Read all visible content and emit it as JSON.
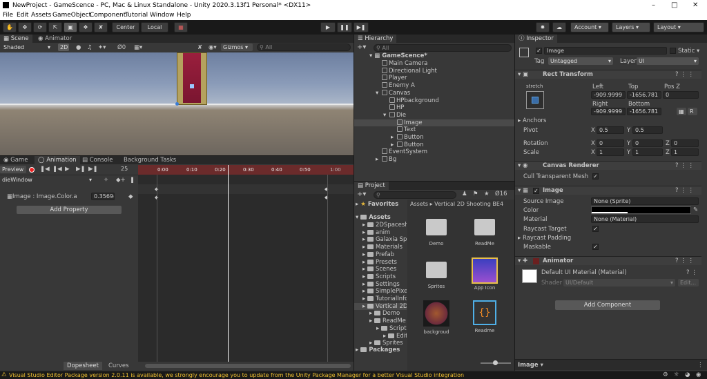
{
  "window": {
    "title": "NewProject - GameScence - PC, Mac & Linux Standalone - Unity 2020.3.13f1 Personal* <DX11>"
  },
  "menu": [
    "File",
    "Edit",
    "Assets",
    "GameObject",
    "Component",
    "Tutorial",
    "Window",
    "Help"
  ],
  "toolbar": {
    "center": "Center",
    "local": "Local",
    "account": "Account",
    "layers": "Layers",
    "layout": "Layout"
  },
  "scene": {
    "tab_scene": "Scene",
    "tab_animator": "Animator",
    "shading": "Shaded",
    "mode2d": "2D",
    "gizmos": "Gizmos",
    "search_placeholder": "All",
    "fx": "0"
  },
  "animation": {
    "tabs": [
      "Game",
      "Animation",
      "Console",
      "Background Tasks"
    ],
    "preview": "Preview",
    "frame": "25",
    "clip": "dieWindow",
    "property": "Image : Image.Color.a",
    "property_value": "0.3569(",
    "add_property": "Add Property",
    "times": [
      "0:00",
      "0:10",
      "0:20",
      "0:30",
      "0:40",
      "0:50",
      "1:00"
    ],
    "dopesheet": "Dopesheet",
    "curves": "Curves"
  },
  "hierarchy": {
    "title": "Hierarchy",
    "search_placeholder": "All",
    "scene": "GameScence*",
    "items": [
      {
        "label": "Main Camera",
        "depth": 1
      },
      {
        "label": "Directional Light",
        "depth": 1
      },
      {
        "label": "Player",
        "depth": 1
      },
      {
        "label": "Enemy A",
        "depth": 1
      },
      {
        "label": "Canvas",
        "depth": 1
      },
      {
        "label": "HPbackground",
        "depth": 2
      },
      {
        "label": "HP",
        "depth": 2
      },
      {
        "label": "Die",
        "depth": 2
      },
      {
        "label": "Image",
        "depth": 3
      },
      {
        "label": "Text",
        "depth": 3
      },
      {
        "label": "Button",
        "depth": 3
      },
      {
        "label": "Button",
        "depth": 3
      },
      {
        "label": "EventSystem",
        "depth": 1
      },
      {
        "label": "Bg",
        "depth": 1
      }
    ]
  },
  "project": {
    "title": "Project",
    "count": "16",
    "favorites": "Favorites",
    "assets": "Assets",
    "packages": "Packages",
    "folders": [
      "2DSpacesh",
      "anim",
      "Galaxia Spr",
      "Materials",
      "Prefab",
      "Presets",
      "Scenes",
      "Scripts",
      "Settings",
      "SimplePixel",
      "TutorialInfo",
      "Vertical 2D"
    ],
    "subfolders": [
      "Demo",
      "ReadMe",
      "Scripts",
      "Edit",
      "Sprites"
    ],
    "breadcrumb_root": "Assets",
    "breadcrumb_leaf": "Vertical 2D Shooting BE4",
    "grid": [
      "Demo",
      "ReadMe",
      "Sprites",
      "App Icon",
      "backgroud",
      "Readme"
    ]
  },
  "inspector": {
    "title": "Inspector",
    "object": "Image",
    "static": "Static",
    "tag_label": "Tag",
    "tag": "Untagged",
    "layer_label": "Layer",
    "layer": "UI",
    "rect_transform": "Rect Transform",
    "stretch": "stretch",
    "left": "Left",
    "left_v": "-909.9999",
    "top": "Top",
    "top_v": "-1656.781",
    "posz": "Pos Z",
    "posz_v": "0",
    "right": "Right",
    "right_v": "-909.9999",
    "bottom": "Bottom",
    "bottom_v": "-1656.781",
    "anchors": "Anchors",
    "pivot": "Pivot",
    "pivot_x": "0.5",
    "pivot_y": "0.5",
    "rotation": "Rotation",
    "rot_x": "0",
    "rot_y": "0",
    "rot_z": "0",
    "scale": "Scale",
    "scale_x": "1",
    "scale_y": "1",
    "scale_z": "1",
    "canvas_renderer": "Canvas Renderer",
    "cull": "Cull Transparent Mesh",
    "image": "Image",
    "source_image": "Source Image",
    "source_image_v": "None (Sprite)",
    "color": "Color",
    "material": "Material",
    "material_v": "None (Material)",
    "raycast_target": "Raycast Target",
    "raycast_padding": "Raycast Padding",
    "maskable": "Maskable",
    "animator": "Animator",
    "default_mat": "Default UI Material (Material)",
    "shader": "Shader",
    "shader_v": "UI/Default",
    "edit": "Edit...",
    "add_component": "Add Component",
    "footer": "Image"
  },
  "status": {
    "message": "Visual Studio Editor Package version 2.0.11 is available, we strongly encourage you to update from the Unity Package Manager for a better Visual Studio integration"
  }
}
